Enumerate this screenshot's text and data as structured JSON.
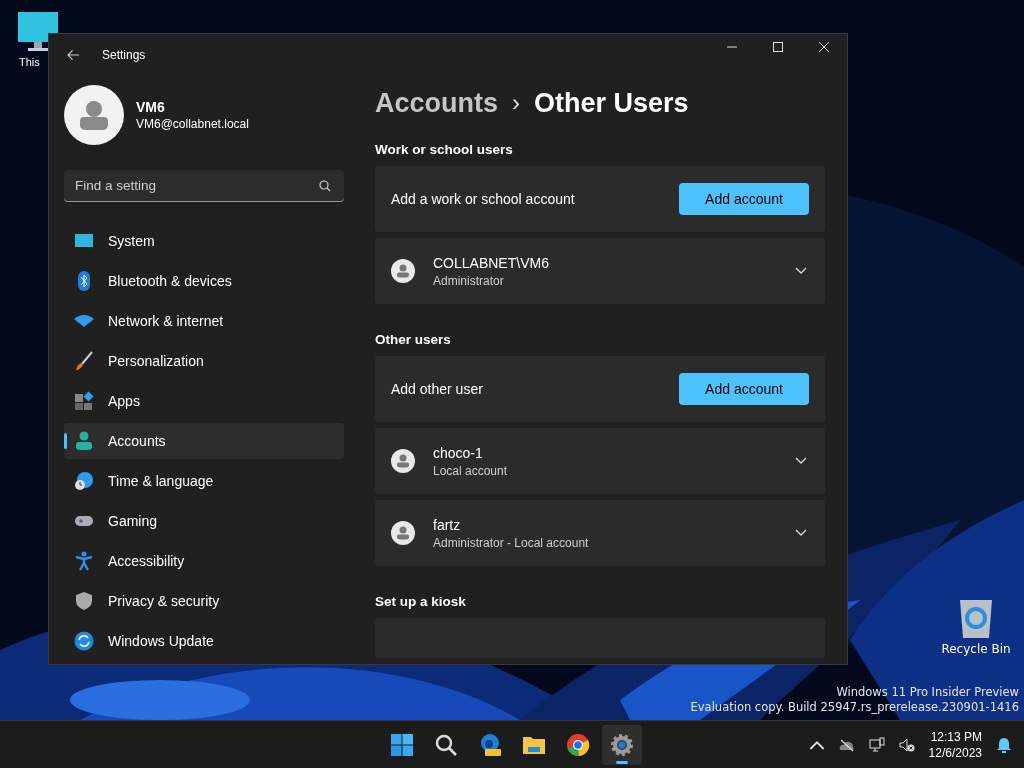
{
  "desktop": {
    "icons": [
      {
        "kind": "pc",
        "label": "This"
      },
      {
        "kind": "bin",
        "label": "Recycle Bin"
      }
    ],
    "watermark": [
      "Windows 11 Pro Insider Preview",
      "Evaluation copy. Build 25947.rs_prerelease.230901-1416"
    ]
  },
  "window": {
    "title": "Settings",
    "profile": {
      "name": "VM6",
      "email": "VM6@collabnet.local"
    },
    "search": {
      "placeholder": "Find a setting"
    },
    "nav": [
      {
        "label": "System",
        "kind": "system",
        "selected": false
      },
      {
        "label": "Bluetooth & devices",
        "kind": "bluetooth",
        "selected": false
      },
      {
        "label": "Network & internet",
        "kind": "wifi",
        "selected": false
      },
      {
        "label": "Personalization",
        "kind": "brush",
        "selected": false
      },
      {
        "label": "Apps",
        "kind": "apps",
        "selected": false
      },
      {
        "label": "Accounts",
        "kind": "person",
        "selected": true
      },
      {
        "label": "Time & language",
        "kind": "globe",
        "selected": false
      },
      {
        "label": "Gaming",
        "kind": "gamepad",
        "selected": false
      },
      {
        "label": "Accessibility",
        "kind": "accessibility",
        "selected": false
      },
      {
        "label": "Privacy & security",
        "kind": "shield",
        "selected": false
      },
      {
        "label": "Windows Update",
        "kind": "update",
        "selected": false
      }
    ],
    "breadcrumb": {
      "parent": "Accounts",
      "separator": "›",
      "current": "Other Users"
    },
    "sections": [
      {
        "heading": "Work or school users",
        "rows": [
          {
            "kind": "action",
            "label": "Add a work or school account",
            "button": "Add account"
          },
          {
            "kind": "user",
            "name": "COLLABNET\\VM6",
            "detail": "Administrator",
            "expanded": false
          }
        ]
      },
      {
        "heading": "Other users",
        "rows": [
          {
            "kind": "action",
            "label": "Add other user",
            "button": "Add account"
          },
          {
            "kind": "user",
            "name": "choco-1",
            "detail": "Local account",
            "expanded": false
          },
          {
            "kind": "user",
            "name": "fartz",
            "detail": "Administrator - Local account",
            "expanded": false
          }
        ]
      },
      {
        "heading": "Set up a kiosk",
        "rows": [
          {
            "kind": "partial"
          }
        ]
      }
    ]
  },
  "taskbar": {
    "apps": [
      {
        "kind": "start",
        "active": false
      },
      {
        "kind": "search",
        "active": false
      },
      {
        "kind": "edge",
        "active": false
      },
      {
        "kind": "folder",
        "active": false
      },
      {
        "kind": "chrome",
        "active": false
      },
      {
        "kind": "settings",
        "active": true
      }
    ],
    "time": "12:13 PM",
    "date": "12/6/2023"
  }
}
